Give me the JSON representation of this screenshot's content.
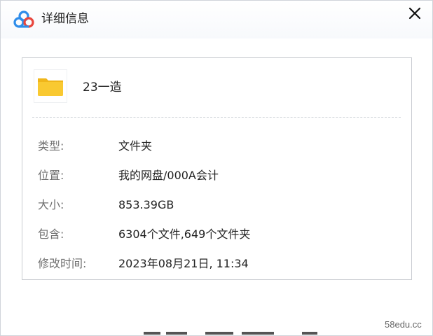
{
  "window": {
    "title": "详细信息",
    "close_label": "×"
  },
  "file": {
    "name": "23一造"
  },
  "details": [
    {
      "label": "类型:",
      "value": "文件夹"
    },
    {
      "label": "位置:",
      "value": "我的网盘/000A会计"
    },
    {
      "label": "大小:",
      "value": "853.39GB"
    },
    {
      "label": "包含:",
      "value": "6304个文件,649个文件夹"
    },
    {
      "label": "修改时间:",
      "value": "2023年08月21日, 11:34"
    }
  ],
  "watermark": "58edu.cc",
  "colors": {
    "folder": "#f9c931",
    "folder_dark": "#f0b61a",
    "logo_blue": "#2f8dea",
    "logo_red": "#e8463d"
  },
  "icons": {
    "app": "baidu-netdisk-cloud-icon",
    "close": "close-icon",
    "file": "folder-icon"
  }
}
